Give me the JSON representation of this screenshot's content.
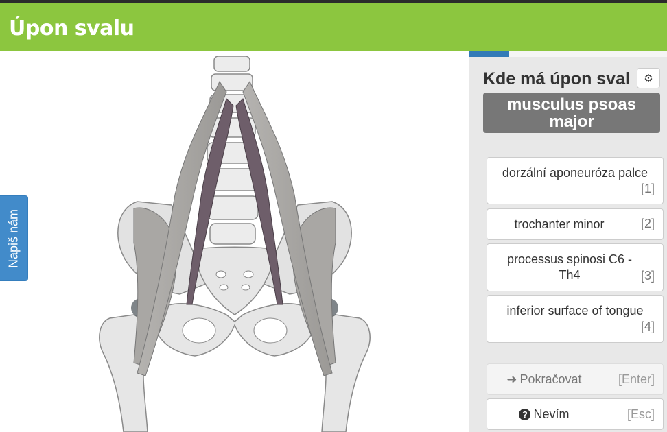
{
  "app": {
    "title": "Úpon svalu"
  },
  "feedback": {
    "label": "Napiš nám"
  },
  "progress": {
    "fraction": 0.2
  },
  "question": {
    "prompt": "Kde má úpon sval",
    "term": "musculus psoas major"
  },
  "settings": {
    "icon": "gear-icon"
  },
  "options": [
    {
      "label": "dorzální aponeuróza palce",
      "key": "[1]"
    },
    {
      "label": "trochanter minor",
      "key": "[2]"
    },
    {
      "label": "processus spinosi C6 - Th4",
      "key": "[3]"
    },
    {
      "label": "inferior surface of tongue",
      "key": "[4]"
    }
  ],
  "actions": {
    "continue_label": "Pokračovat",
    "continue_key": "[Enter]",
    "dontknow_label": "Nevím",
    "dontknow_key": "[Esc]"
  },
  "colors": {
    "header": "#8cc63f",
    "muscle": "#6e5e6a",
    "bone": "#e0e0e0",
    "term_bg": "#777777",
    "feedback": "#428bca"
  }
}
